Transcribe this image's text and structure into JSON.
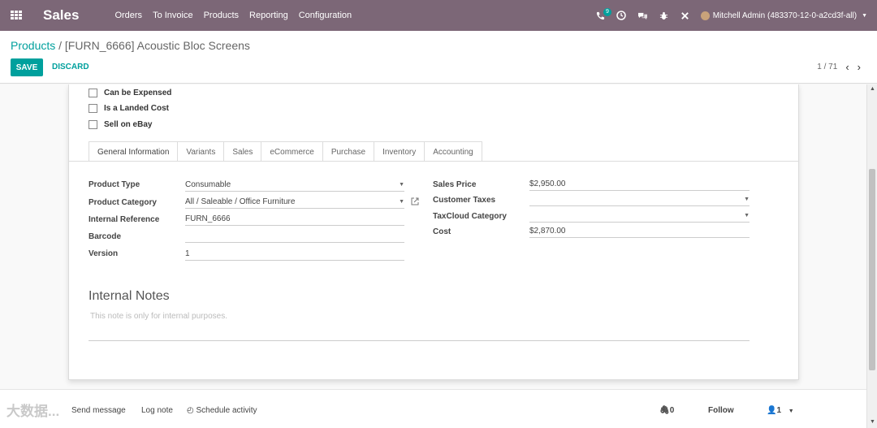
{
  "nav": {
    "app_name": "Sales",
    "menu": [
      "Orders",
      "To Invoice",
      "Products",
      "Reporting",
      "Configuration"
    ],
    "activity_count": "9",
    "user": "Mitchell Admin (483370-12-0-a2cd3f-all)"
  },
  "breadcrumb": {
    "parent": "Products",
    "separator": "/",
    "current": "[FURN_6666] Acoustic Bloc Screens"
  },
  "actions": {
    "save": "SAVE",
    "discard": "DISCARD"
  },
  "pager": {
    "value": "1 / 71"
  },
  "checkboxes": [
    "Can be Expensed",
    "Is a Landed Cost",
    "Sell on eBay"
  ],
  "tabs": [
    "General Information",
    "Variants",
    "Sales",
    "eCommerce",
    "Purchase",
    "Inventory",
    "Accounting"
  ],
  "general": {
    "product_type_label": "Product Type",
    "product_type_value": "Consumable",
    "product_category_label": "Product Category",
    "product_category_value": "All / Saleable / Office Furniture",
    "internal_reference_label": "Internal Reference",
    "internal_reference_value": "FURN_6666",
    "barcode_label": "Barcode",
    "barcode_value": "",
    "version_label": "Version",
    "version_value": "1",
    "sales_price_label": "Sales Price",
    "sales_price_value": "$2,950.00",
    "customer_taxes_label": "Customer Taxes",
    "customer_taxes_value": "",
    "taxcloud_label": "TaxCloud Category",
    "taxcloud_value": "",
    "cost_label": "Cost",
    "cost_value": "$2,870.00"
  },
  "notes": {
    "title": "Internal Notes",
    "placeholder": "This note is only for internal purposes."
  },
  "chatter": {
    "send_message": "Send message",
    "log_note": "Log note",
    "schedule": "Schedule activity",
    "attachments": "0",
    "follow": "Follow",
    "followers": "1"
  },
  "watermark": "大数据..."
}
